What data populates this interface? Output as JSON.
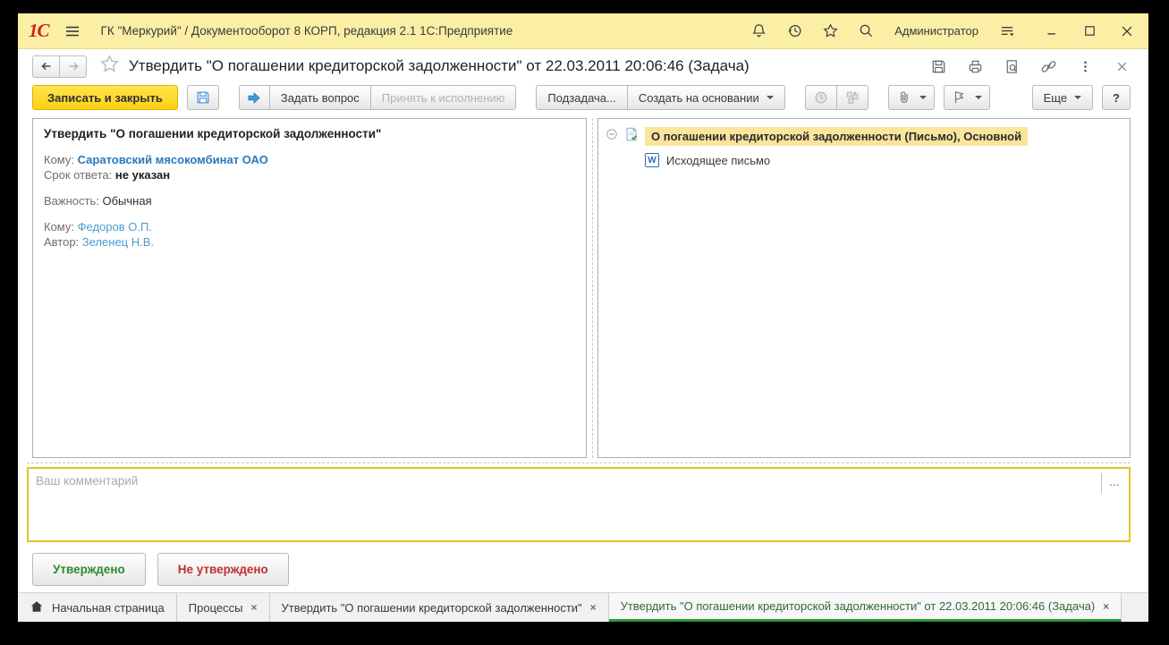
{
  "window": {
    "app_title": "ГК \"Меркурий\" / Документооборот 8 КОРП, редакция 2.1 1С:Предприятие",
    "user": "Администратор",
    "logo": "1С"
  },
  "page": {
    "title": "Утвердить \"О погашении кредиторской задолженности\" от 22.03.2011 20:06:46 (Задача)"
  },
  "toolbar": {
    "save_close": "Записать и закрыть",
    "ask_question": "Задать вопрос",
    "accept_execution": "Принять к исполнению",
    "subtask": "Подзадача...",
    "create_based_on": "Создать на основании",
    "more": "Еще",
    "help": "?"
  },
  "task": {
    "title": "Утвердить \"О погашении кредиторской задолженности\"",
    "to_label": "Кому:",
    "to_value": "Саратовский мясокомбинат ОАО",
    "deadline_label": "Срок ответа:",
    "deadline_value": "не указан",
    "importance_label": "Важность:",
    "importance_value": "Обычная",
    "assignee_label": "Кому:",
    "assignee_value": "Федоров О.П.",
    "author_label": "Автор:",
    "author_value": "Зеленец Н.В."
  },
  "tree": {
    "root_label": "О погашении кредиторской задолженности (Письмо), Основной",
    "child_label": "Исходящее письмо"
  },
  "comment": {
    "placeholder": "Ваш комментарий",
    "more_button": "..."
  },
  "actions": {
    "approved": "Утверждено",
    "not_approved": "Не утверждено"
  },
  "tabs": {
    "0": {
      "label": "Начальная страница"
    },
    "1": {
      "label": "Процессы",
      "close": "×"
    },
    "2": {
      "label": "Утвердить \"О погашении кредиторской задолженности\"",
      "close": "×"
    },
    "3": {
      "label": "Утвердить \"О погашении кредиторской задолженности\" от 22.03.2011 20:06:46 (Задача)",
      "close": "×"
    }
  },
  "colors": {
    "title_bar": "#FBEFA6",
    "primary_button_yellow": "#FCD116",
    "tree_highlight": "#FBE49B",
    "active_tab_green": "#2C9639",
    "link_blue": "#2779BD",
    "approved_green": "#2E8B2E",
    "not_approved_red": "#C23030",
    "comment_border_gold": "#E3C229",
    "logo_red": "#D6201F"
  }
}
